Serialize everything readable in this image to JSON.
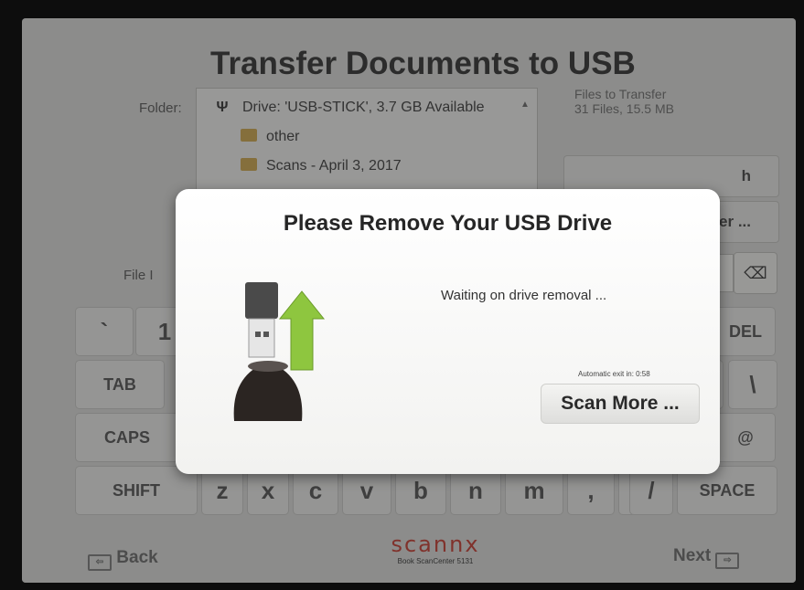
{
  "header": {
    "title": "Transfer Documents to USB",
    "folder_label": "Folder:",
    "files_to_transfer_label": "Files to Transfer",
    "files_to_transfer_value": "31 Files, 15.5 MB"
  },
  "folder_list": {
    "drive": "Drive: 'USB-STICK', 3.7 GB Available",
    "items": [
      "other",
      "Scans - April 3, 2017"
    ]
  },
  "side_buttons": {
    "refresh_partial": "h",
    "new_folder_partial": "er ..."
  },
  "file_name": {
    "label_partial": "File I",
    "backspace_glyph": "⌫"
  },
  "keyboard": {
    "row1": [
      "`",
      "1",
      "DEL"
    ],
    "row2": [
      "TAB",
      "]",
      "\\"
    ],
    "row3": [
      "CAPS",
      "@"
    ],
    "row4": [
      "SHIFT",
      "z",
      "x",
      "c",
      "v",
      "b",
      "n",
      "m",
      ",",
      ".",
      "/",
      "SPACE"
    ]
  },
  "footer": {
    "back_label": "Back",
    "next_label": "Next",
    "brand": "scannx",
    "model": "Book ScanCenter 5131"
  },
  "modal": {
    "title": "Please Remove Your USB Drive",
    "message": "Waiting on drive removal ...",
    "auto_exit": "Automatic exit in: 0:58",
    "scan_more_label": "Scan More ..."
  },
  "icons": {
    "usb": "usb-icon",
    "folder": "folder-icon",
    "backspace": "backspace-icon",
    "back_arrow": "back-arrow-icon",
    "next_arrow": "next-arrow-icon",
    "usb_removal": "usb-removal-illustration"
  },
  "colors": {
    "brand_red": "#c03a30",
    "arrow_green": "#8ec63f",
    "folder_gold": "#c9a34a"
  }
}
